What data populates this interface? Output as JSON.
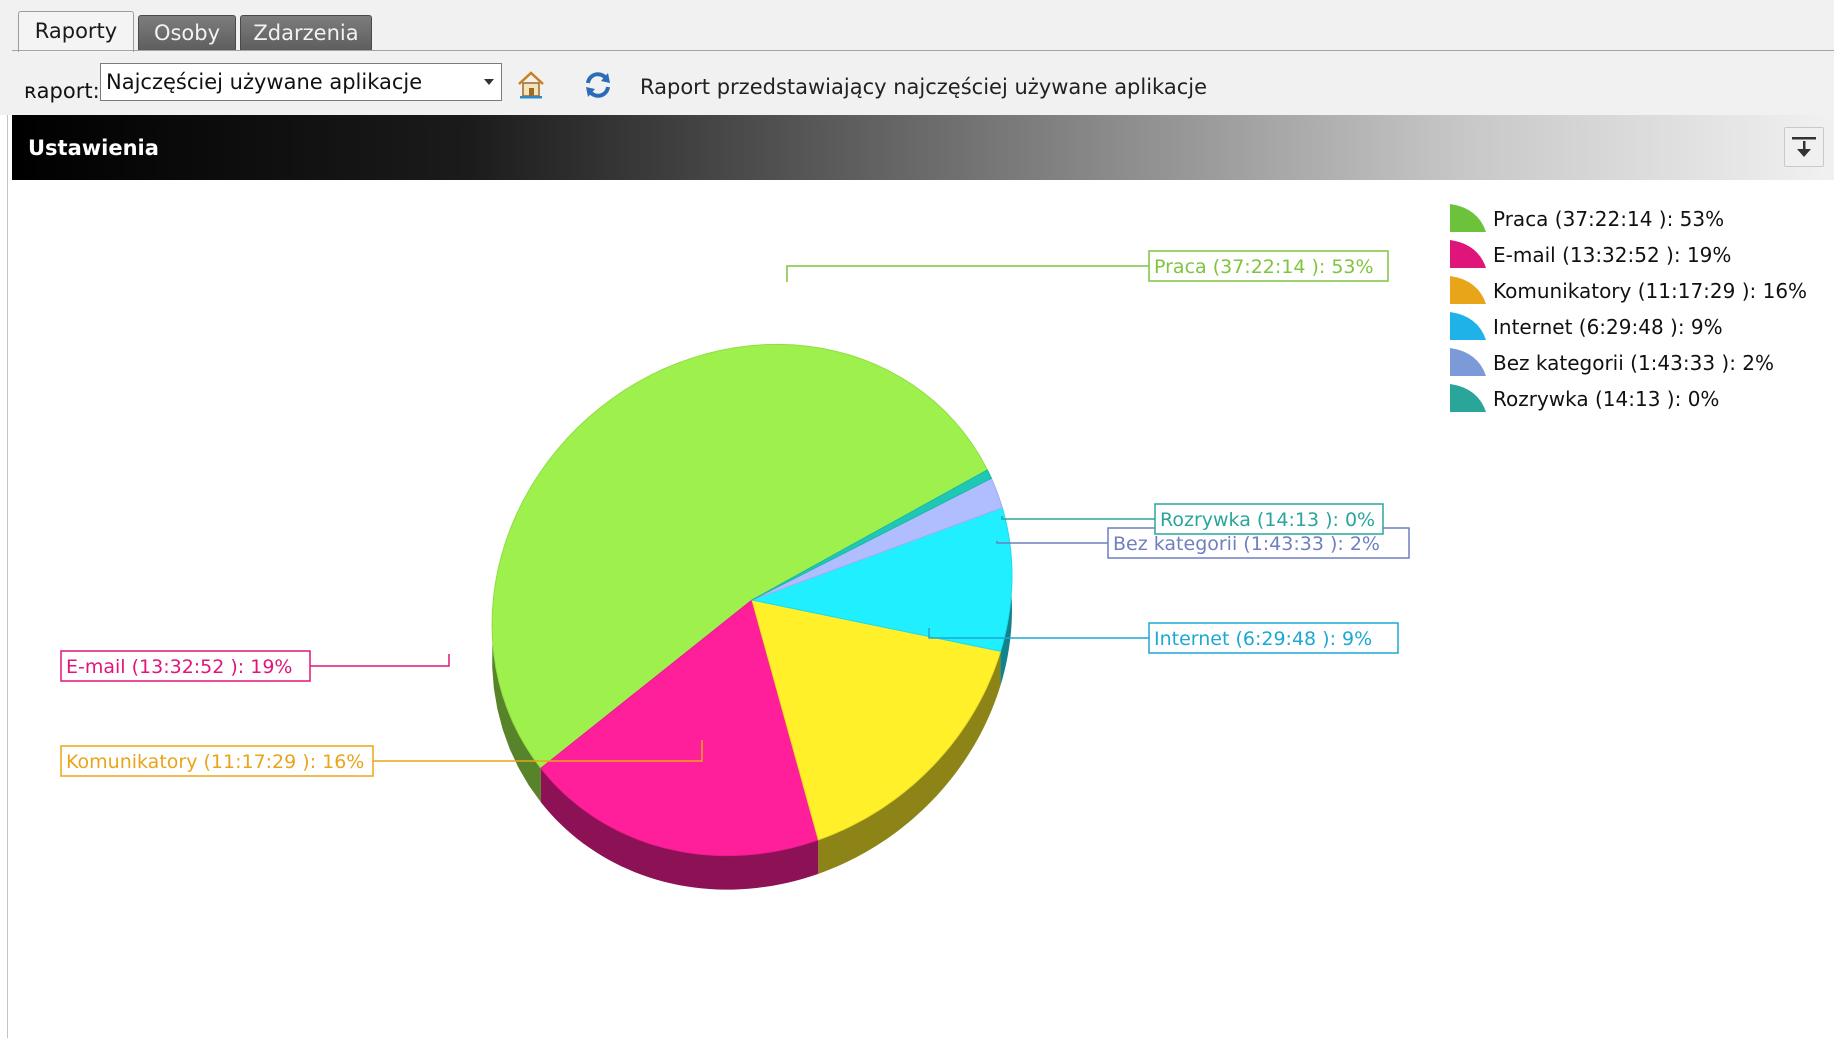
{
  "tabs": [
    {
      "label": "Raporty",
      "active": true
    },
    {
      "label": "Osoby",
      "active": false
    },
    {
      "label": "Zdarzenia",
      "active": false
    }
  ],
  "toolbar": {
    "report_label": "ʀaport:",
    "report_select_value": "Najczęściej używane aplikacje",
    "home_icon": "home-icon",
    "refresh_icon": "refresh-icon",
    "description": "Raport przedstawiający najczęściej używane aplikacje"
  },
  "settings_bar": {
    "title": "Ustawienia",
    "collapse_icon": "collapse-down-icon"
  },
  "chart_data": {
    "type": "pie",
    "style": "3d",
    "legend_position": "top-right",
    "categories": [
      "Praca",
      "E-mail",
      "Komunikatory",
      "Internet",
      "Bez kategorii",
      "Rozrywka"
    ],
    "durations": [
      "37:22:14",
      "13:32:52",
      "11:17:29",
      "6:29:48",
      "1:43:33",
      "14:13"
    ],
    "values": [
      53,
      19,
      16,
      9,
      2,
      0
    ],
    "labels": [
      "Praca (37:22:14 ): 53%",
      "E-mail (13:32:52 ): 19%",
      "Komunikatory (11:17:29 ): 16%",
      "Internet (6:29:48 ): 9%",
      "Bez kategorii (1:43:33 ): 2%",
      "Rozrywka (14:13 ): 0%"
    ],
    "colors": [
      "#9ef04c",
      "#ff1f9a",
      "#fff02a",
      "#1fefff",
      "#b0bdff",
      "#1fc8b4"
    ],
    "legend_colors": [
      "#6cc23a",
      "#e0157a",
      "#e8a51a",
      "#1fb2e8",
      "#7d9ad8",
      "#2aa59a"
    ],
    "callout_colors": [
      "#7fc43c",
      "#e0157a",
      "#e8a51a",
      "#1ca8d4",
      "#6f7fc0",
      "#2aa59a"
    ]
  }
}
